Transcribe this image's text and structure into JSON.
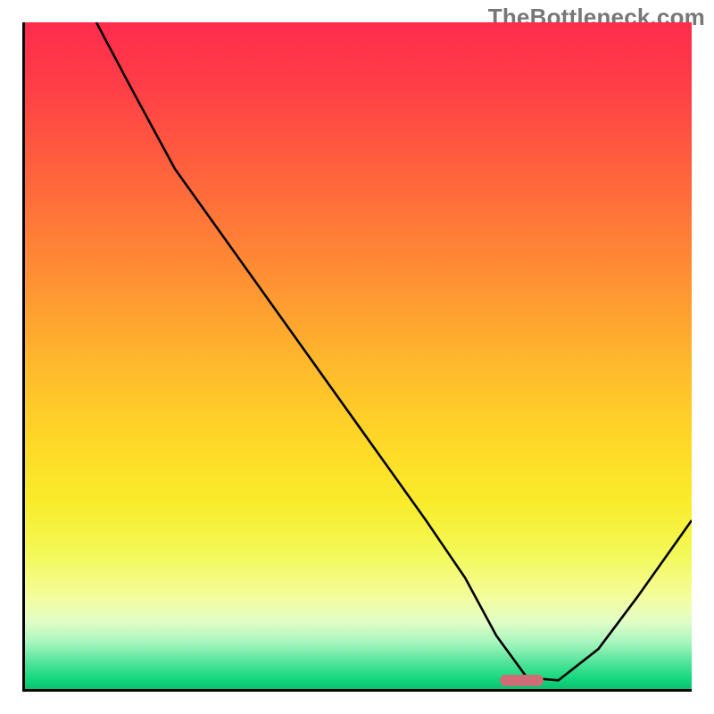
{
  "watermark": "TheBottleneck.com",
  "chart_data": {
    "type": "line",
    "title": "",
    "xlabel": "",
    "ylabel": "",
    "xlim": [
      0,
      100
    ],
    "ylim": [
      0,
      100
    ],
    "grid": false,
    "legend": false,
    "gradient_stops": [
      {
        "pct": 0,
        "color": "#ff2c4d"
      },
      {
        "pct": 10,
        "color": "#ff3f46"
      },
      {
        "pct": 25,
        "color": "#ff6a3b"
      },
      {
        "pct": 38,
        "color": "#ff8f33"
      },
      {
        "pct": 50,
        "color": "#ffb52d"
      },
      {
        "pct": 62,
        "color": "#ffd627"
      },
      {
        "pct": 72,
        "color": "#f9ec2a"
      },
      {
        "pct": 80,
        "color": "#f3f95a"
      },
      {
        "pct": 86.5,
        "color": "#f4fda0"
      },
      {
        "pct": 90,
        "color": "#e0fdc7"
      },
      {
        "pct": 93,
        "color": "#a8f5bf"
      },
      {
        "pct": 96,
        "color": "#52e49a"
      },
      {
        "pct": 98.5,
        "color": "#13d87c"
      },
      {
        "pct": 100,
        "color": "#0cc06e"
      }
    ],
    "series": [
      {
        "name": "bottleneck-curve",
        "x": [
          10.7,
          16.0,
          22.5,
          30.0,
          40.0,
          50.0,
          60.0,
          66.0,
          70.7,
          75.3,
          80.0,
          86.0,
          92.0,
          100.0
        ],
        "y": [
          100.0,
          90.0,
          78.0,
          67.5,
          53.5,
          39.5,
          25.5,
          16.7,
          8.0,
          1.7,
          1.3,
          6.0,
          14.0,
          25.3
        ]
      }
    ],
    "marker": {
      "x": 74.5,
      "y": 1.3,
      "width": 6.5,
      "height": 1.7,
      "color": "#d16b75"
    },
    "axes": {
      "left": true,
      "bottom": true,
      "right": false,
      "top": false
    }
  }
}
